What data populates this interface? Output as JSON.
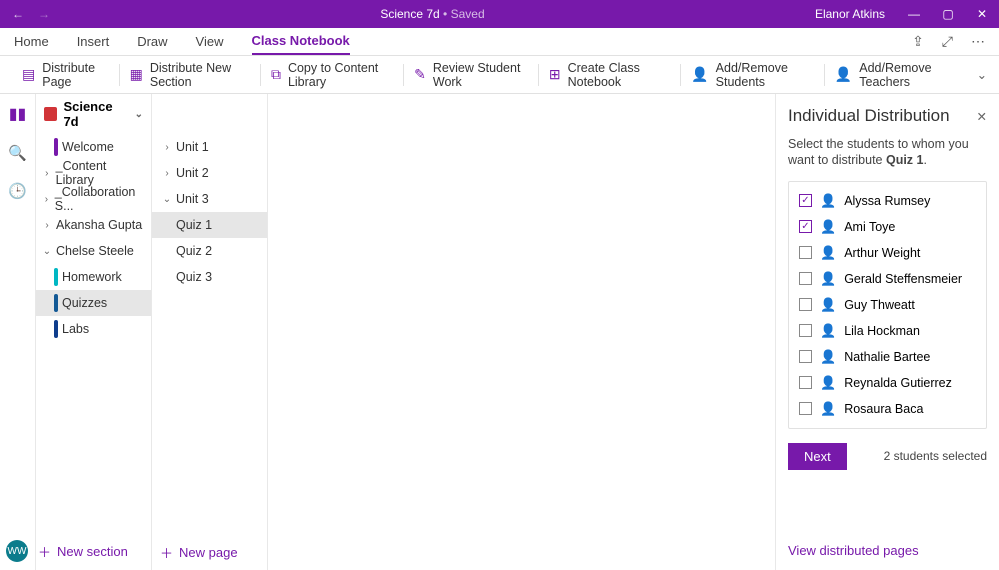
{
  "title": {
    "notebook": "Science 7d",
    "status": "Saved"
  },
  "user": "Elanor Atkins",
  "tabs": [
    "Home",
    "Insert",
    "Draw",
    "View",
    "Class Notebook"
  ],
  "active_tab": 4,
  "ribbon": [
    "Distribute Page",
    "Distribute New Section",
    "Copy to Content Library",
    "Review Student Work",
    "Create Class Notebook",
    "Add/Remove Students",
    "Add/Remove Teachers"
  ],
  "notebook_name": "Science 7d",
  "sections": [
    {
      "label": "Welcome",
      "color": "#7719aa",
      "type": "bar"
    },
    {
      "label": "_Content Library",
      "type": "expand"
    },
    {
      "label": "_Collaboration S...",
      "type": "expand"
    },
    {
      "label": "Akansha Gupta",
      "type": "expand"
    },
    {
      "label": "Chelse Steele",
      "type": "collapse"
    },
    {
      "label": "Homework",
      "color": "#00b7c3",
      "type": "child"
    },
    {
      "label": "Quizzes",
      "color": "#135995",
      "type": "child",
      "selected": true
    },
    {
      "label": "Labs",
      "color": "#0f3d8c",
      "type": "child"
    }
  ],
  "units": [
    {
      "label": "Unit 1",
      "type": "expand"
    },
    {
      "label": "Unit 2",
      "type": "expand"
    },
    {
      "label": "Unit 3",
      "type": "collapse"
    }
  ],
  "pages": [
    {
      "label": "Quiz 1",
      "selected": true
    },
    {
      "label": "Quiz 2"
    },
    {
      "label": "Quiz 3"
    }
  ],
  "add_section": "New section",
  "add_page": "New page",
  "avatar_initials": "WW",
  "panel": {
    "title": "Individual Distribution",
    "desc_pre": "Select the students to whom you want to distribute ",
    "desc_bold": "Quiz 1",
    "students": [
      {
        "name": "Alyssa Rumsey",
        "checked": true
      },
      {
        "name": "Ami Toye",
        "checked": true
      },
      {
        "name": "Arthur Weight",
        "checked": false
      },
      {
        "name": "Gerald Steffensmeier",
        "checked": false
      },
      {
        "name": "Guy Thweatt",
        "checked": false
      },
      {
        "name": "Lila Hockman",
        "checked": false
      },
      {
        "name": "Nathalie Bartee",
        "checked": false
      },
      {
        "name": "Reynalda Gutierrez",
        "checked": false
      },
      {
        "name": "Rosaura Baca",
        "checked": false
      }
    ],
    "next": "Next",
    "count": "2 students selected",
    "link": "View distributed pages"
  }
}
